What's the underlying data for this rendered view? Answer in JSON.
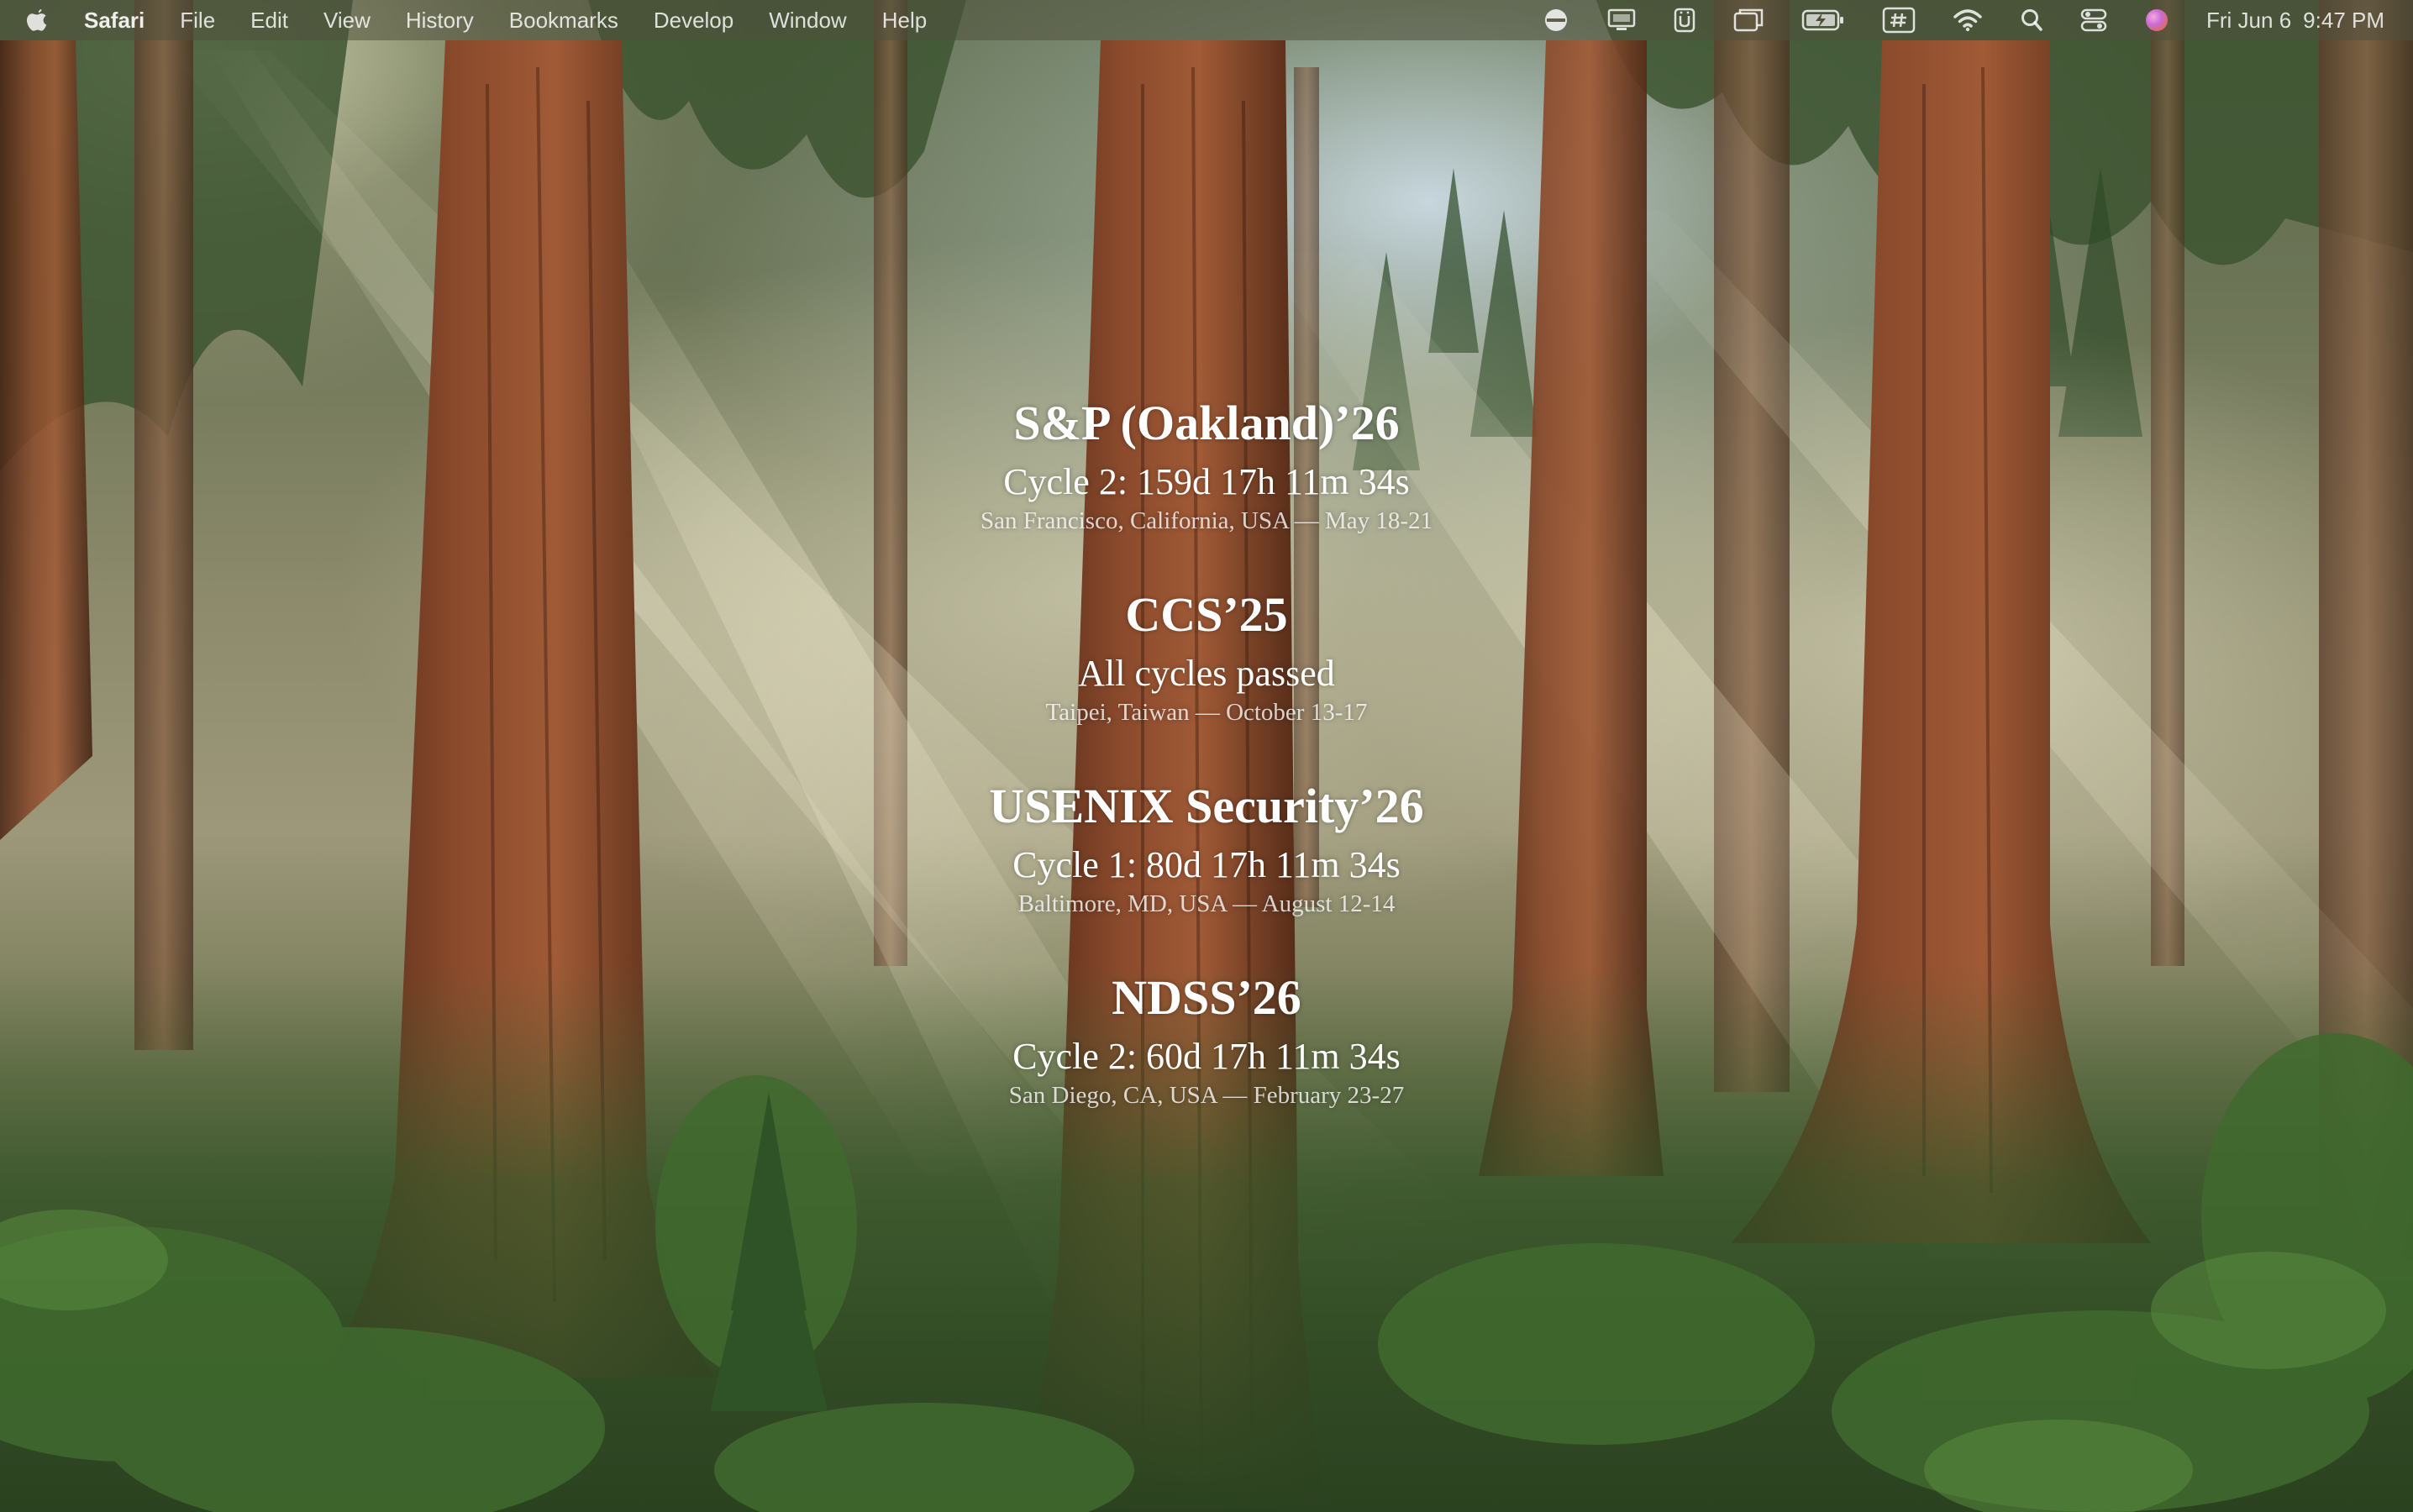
{
  "menubar": {
    "app_name": "Safari",
    "menus": [
      "File",
      "Edit",
      "View",
      "History",
      "Bookmarks",
      "Develop",
      "Window",
      "Help"
    ],
    "status_icons": [
      "vpn-icon",
      "display-icon",
      "text-input-icon",
      "screen-mirroring-icon",
      "battery-charging-icon",
      "hashtag-icon",
      "wifi-icon",
      "spotlight-search-icon",
      "control-center-icon",
      "siri-icon"
    ],
    "clock": {
      "date": "Fri Jun 6",
      "time": "9:47 PM"
    }
  },
  "countdown": {
    "conferences": [
      {
        "title": "S&P (Oakland)’26",
        "status": "Cycle 2: 159d 17h 11m 34s",
        "place": "San Francisco, California, USA — May 18-21"
      },
      {
        "title": "CCS’25",
        "status": "All cycles passed",
        "place": "Taipei, Taiwan — October 13-17"
      },
      {
        "title": "USENIX Security’26",
        "status": "Cycle 1: 80d 17h 11m 34s",
        "place": "Baltimore, MD, USA — August 12-14"
      },
      {
        "title": "NDSS’26",
        "status": "Cycle 2: 60d 17h 11m 34s",
        "place": "San Diego, CA, USA — February 23-27"
      }
    ]
  },
  "wallpaper": {
    "subject": "sequoia forest with sun rays",
    "colors": {
      "trunk": "#6e3420",
      "foliage": "#3b5a2c",
      "mist": "#e8e4c8"
    }
  }
}
